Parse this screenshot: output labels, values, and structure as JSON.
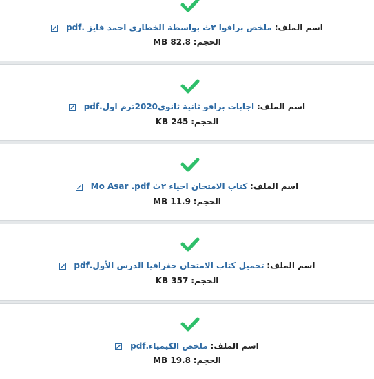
{
  "colors": {
    "check": "#2ebf6a",
    "link": "#2e6aa3",
    "separator": "#e5e8ea"
  },
  "files": [
    {
      "name_label": "اسم الملف:",
      "file_name": "ملخص برافوا ٢ث بواسطة الخطاري احمد فايز .pdf",
      "size_label": "الحجم:",
      "size": "82.8 MB"
    },
    {
      "name_label": "اسم الملف:",
      "file_name": "اجابات برافو ثانية ثانوي2020ترم اول.pdf",
      "size_label": "الحجم:",
      "size": "245 KB"
    },
    {
      "name_label": "اسم الملف:",
      "file_name": "كتاب الامتحان احياء ٢ث Mo Asar .pdf",
      "size_label": "الحجم:",
      "size": "11.9 MB"
    },
    {
      "name_label": "اسم الملف:",
      "file_name": "تحميل كتاب الامتحان جغرافيا الدرس الأول.pdf",
      "size_label": "الحجم:",
      "size": "357 KB"
    },
    {
      "name_label": "اسم الملف:",
      "file_name": "ملخص الكيمياء.pdf",
      "size_label": "الحجم:",
      "size": "19.8 MB"
    }
  ]
}
